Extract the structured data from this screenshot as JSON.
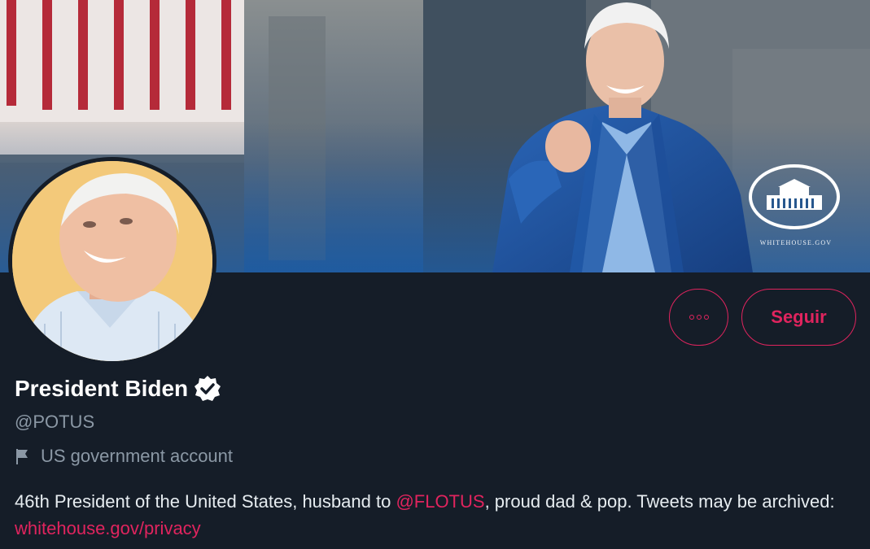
{
  "profile": {
    "display_name": "President Biden",
    "handle": "@POTUS",
    "account_type_label": "US government account",
    "bio": {
      "text_before_mention": "46th President of the United States, husband to ",
      "mention": "@FLOTUS",
      "text_after_mention": ", proud dad & pop. Tweets may be archived: ",
      "link": "whitehouse.gov/privacy"
    }
  },
  "actions": {
    "more_icon": "more-horizontal-icon",
    "follow_label": "Seguir"
  },
  "banner": {
    "watermark_text": "WHITEHOUSE.GOV"
  },
  "icons": {
    "verified": "verified-badge-icon",
    "account_type": "flag-icon"
  },
  "colors": {
    "background": "#151d28",
    "accent": "#e0245e",
    "secondary_text": "#8b98a5",
    "primary_text": "#ffffff"
  }
}
